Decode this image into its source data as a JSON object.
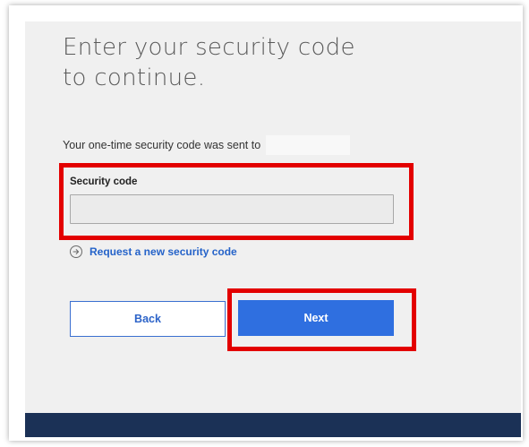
{
  "form": {
    "heading_line1": "Enter your security code",
    "heading_line2": "to continue.",
    "sent_message": "Your one-time security code was sent to",
    "security_code_label": "Security code",
    "security_code_value": "",
    "request_new_code_label": "Request a new security code"
  },
  "buttons": {
    "back_label": "Back",
    "next_label": "Next"
  },
  "colors": {
    "primary": "#2f6fe0",
    "link": "#2563c9",
    "footer": "#1b3156",
    "highlight": "#e30000",
    "card_background": "#f0f0f0"
  },
  "icons": {
    "request_new_code": "circle-arrow-right-icon"
  }
}
